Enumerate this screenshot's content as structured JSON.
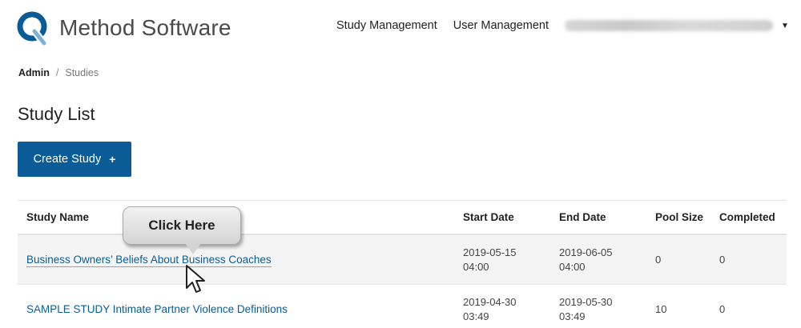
{
  "header": {
    "app_name": "Method Software",
    "nav": [
      {
        "label": "Study Management"
      },
      {
        "label": "User Management"
      }
    ],
    "brand_color": "#0b5c96"
  },
  "breadcrumb": {
    "admin": "Admin",
    "separator": "/",
    "current": "Studies"
  },
  "page": {
    "title": "Study List",
    "create_button_label": "Create Study",
    "create_button_icon": "+"
  },
  "table": {
    "columns": [
      "Study Name",
      "Start Date",
      "End Date",
      "Pool Size",
      "Completed"
    ],
    "rows": [
      {
        "name": "Business Owners’ Beliefs About Business Coaches",
        "start_date": "2019-05-15",
        "start_time": "04:00",
        "end_date": "2019-06-05",
        "end_time": "04:00",
        "pool_size": "0",
        "completed": "0"
      },
      {
        "name": "SAMPLE STUDY Intimate Partner Violence Definitions",
        "start_date": "2019-04-30",
        "start_time": "03:49",
        "end_date": "2019-05-30",
        "end_time": "03:49",
        "pool_size": "10",
        "completed": "0"
      }
    ]
  },
  "annotation": {
    "callout_text": "Click Here"
  }
}
